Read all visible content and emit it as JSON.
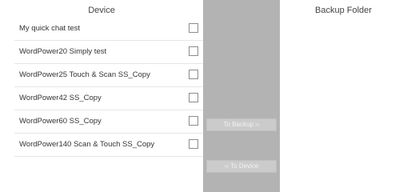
{
  "device": {
    "header": "Device",
    "items": [
      {
        "label": "My quick chat test",
        "checked": false
      },
      {
        "label": "WordPower20 Simply test",
        "checked": false
      },
      {
        "label": "WordPower25 Touch & Scan SS_Copy",
        "checked": false
      },
      {
        "label": "WordPower42 SS_Copy",
        "checked": false
      },
      {
        "label": "WordPower60 SS_Copy",
        "checked": false
      },
      {
        "label": "WordPower140 Scan & Touch SS_Copy",
        "checked": false
      }
    ]
  },
  "transfer": {
    "to_backup_label": "To Backup ››",
    "to_device_label": "‹‹ To Device"
  },
  "backup": {
    "header": "Backup Folder",
    "items": []
  },
  "colors": {
    "divider": "#b3b3b3",
    "button_bg": "#cbcbcb",
    "button_text": "#f2f2f2"
  }
}
